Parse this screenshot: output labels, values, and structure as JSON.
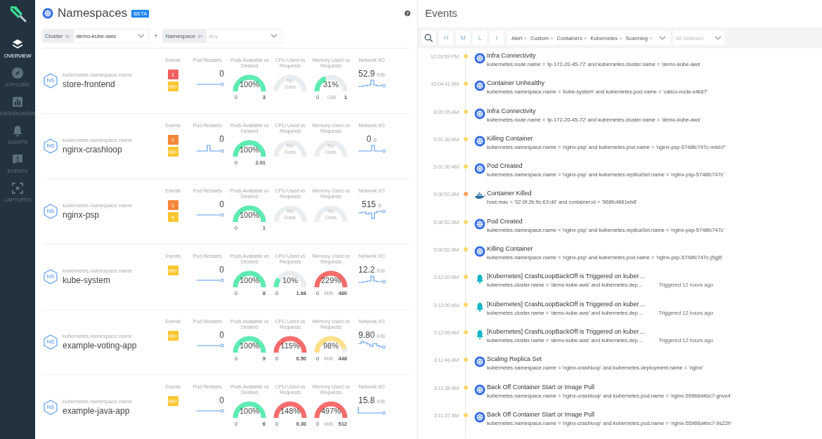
{
  "sidebar": {
    "items": [
      {
        "label": "OVERVIEW",
        "selected": true
      },
      {
        "label": "EXPLORE",
        "selected": false
      },
      {
        "label": "DASHBOARDS",
        "selected": false
      },
      {
        "label": "ALERTS",
        "selected": false
      },
      {
        "label": "EVENTS",
        "selected": false
      },
      {
        "label": "CAPTURES",
        "selected": false
      }
    ]
  },
  "namespaces": {
    "title": "Namespaces",
    "badge": "BETA",
    "help": "?",
    "joiner": "+",
    "filters": [
      {
        "label": "Cluster",
        "operator": "is",
        "value": "demo-kube-aws"
      },
      {
        "label": "Namespace",
        "operator": "in",
        "placeholder": "any"
      }
    ],
    "rows": [
      {
        "field": "kubernetes.namespace.name",
        "name": "store-frontend",
        "icon_text": "NS",
        "headers": [
          "Events",
          "Pod Restarts",
          "Pods Available vs Desired",
          "CPU Used vs Requests",
          "Memory Used vs Requests",
          "Network I/O"
        ],
        "events": [
          {
            "text": "1",
            "color": "#f25e5e"
          },
          {
            "text": "99+",
            "color": "#fcc630"
          }
        ],
        "restarts": {
          "value": "0"
        },
        "gauges": [
          {
            "kind": "gauge",
            "value": "100%",
            "level": 1,
            "color": "#5debb3",
            "min": "0",
            "max": "3"
          },
          {
            "kind": "no_data",
            "value": "No Data"
          },
          {
            "kind": "gauge",
            "value": "31%",
            "level": 0.31,
            "color": "#5debb3",
            "min": "0",
            "max": "1",
            "unit": "GiB"
          }
        ],
        "network": {
          "value": "52.9",
          "unit": "KiB"
        }
      },
      {
        "field": "kubernetes.namespace.name",
        "name": "nginx-crashloop",
        "icon_text": "NS",
        "headers": [
          "Events",
          "Pod Restarts",
          "Pods Available vs Desired",
          "CPU Used vs Requests",
          "Memory Used vs Requests",
          "Network I/O"
        ],
        "events": [
          {
            "text": "1",
            "color": "#f5873a"
          },
          {
            "text": "99+",
            "color": "#fcc630"
          }
        ],
        "restarts": {
          "value": "0"
        },
        "gauges": [
          {
            "kind": "gauge",
            "value": "100%",
            "level": 1,
            "color": "#5debb3",
            "min": "0",
            "max": "2.01"
          },
          {
            "kind": "no_data",
            "value": "No Data"
          },
          {
            "kind": "no_data",
            "value": "No Data"
          }
        ],
        "network": {
          "value": "0",
          "unit": "B"
        }
      },
      {
        "field": "kubernetes.namespace.name",
        "name": "nginx-psp",
        "icon_text": "NS",
        "headers": [
          "Events",
          "Pod Restarts",
          "Pods Available vs Desired",
          "CPU Used vs Requests",
          "Memory Used vs Requests",
          "Network I/O"
        ],
        "events": [
          {
            "text": "1",
            "color": "#f5873a"
          },
          {
            "text": "4",
            "color": "#fcc630"
          }
        ],
        "restarts": {
          "value": "0"
        },
        "gauges": [
          {
            "kind": "gauge",
            "value": "100%",
            "level": 1,
            "color": "#5debb3",
            "min": "0",
            "max": "1"
          },
          {
            "kind": "no_data",
            "value": "No Data"
          },
          {
            "kind": "no_data",
            "value": "No Data"
          }
        ],
        "network": {
          "value": "515",
          "unit": "B"
        }
      },
      {
        "field": "kubernetes.namespace.name",
        "name": "kube-system",
        "icon_text": "NS",
        "headers": [
          "Events",
          "Pod Restarts",
          "Pods Available vs Desired",
          "CPU Used vs Requests",
          "Memory Used vs Requests",
          "Network I/O"
        ],
        "events": [
          {
            "text": "99+",
            "color": "#fcc630"
          }
        ],
        "restarts": {
          "value": "0"
        },
        "gauges": [
          {
            "kind": "gauge",
            "value": "100%",
            "level": 1,
            "color": "#5debb3",
            "min": "0",
            "max": "8"
          },
          {
            "kind": "gauge",
            "value": "10%",
            "level": 0.1,
            "color": "#5debb3",
            "min": "0",
            "max": "1.68"
          },
          {
            "kind": "gauge",
            "value": "229%",
            "level": 1,
            "color": "#f76c6c",
            "min": "0",
            "max": "480",
            "unit": "MiB"
          }
        ],
        "network": {
          "value": "12.2",
          "unit": "KiB"
        }
      },
      {
        "field": "kubernetes.namespace.name",
        "name": "example-voting-app",
        "icon_text": "NS",
        "headers": [
          "Events",
          "Pod Restarts",
          "Pods Available vs Desired",
          "CPU Used vs Requests",
          "Memory Used vs Requests",
          "Network I/O"
        ],
        "events": [
          {
            "text": "99+",
            "color": "#fcc630"
          }
        ],
        "restarts": {
          "value": "0"
        },
        "gauges": [
          {
            "kind": "gauge",
            "value": "100%",
            "level": 1,
            "color": "#5debb3",
            "min": "0",
            "max": "9"
          },
          {
            "kind": "gauge",
            "value": "115%",
            "level": 1,
            "color": "#f76c6c",
            "min": "0",
            "max": "0.50"
          },
          {
            "kind": "gauge",
            "value": "98%",
            "level": 0.98,
            "color": "#fde08a",
            "min": "0",
            "max": "448",
            "unit": "MiB"
          }
        ],
        "network": {
          "value": "9.80",
          "unit": "KiB"
        }
      },
      {
        "field": "kubernetes.namespace.name",
        "name": "example-java-app",
        "icon_text": "NS",
        "headers": [
          "Events",
          "Pod Restarts",
          "Pods Available vs Desired",
          "CPU Used vs Requests",
          "Memory Used vs Requests",
          "Network I/O"
        ],
        "events": [
          {
            "text": "99+",
            "color": "#fcc630"
          }
        ],
        "restarts": {
          "value": "0"
        },
        "gauges": [
          {
            "kind": "gauge",
            "value": "100%",
            "level": 1,
            "color": "#5debb3",
            "min": "0",
            "max": "6"
          },
          {
            "kind": "gauge",
            "value": "148%",
            "level": 1,
            "color": "#f76c6c",
            "min": "0",
            "max": "0.30"
          },
          {
            "kind": "gauge",
            "value": "497%",
            "level": 1,
            "color": "#f76c6c",
            "min": "0",
            "max": "512",
            "unit": "MiB"
          }
        ],
        "network": {
          "value": "15.8",
          "unit": "KiB"
        }
      }
    ]
  },
  "events": {
    "title": "Events",
    "severities": [
      {
        "label": "H",
        "selected": false
      },
      {
        "label": "M",
        "selected": false
      },
      {
        "label": "L",
        "selected": false
      },
      {
        "label": "I",
        "selected": false
      }
    ],
    "tags": [
      {
        "label": "Alert",
        "remove": "×"
      },
      {
        "label": "Custom",
        "remove": "×"
      },
      {
        "label": "Containers",
        "remove": "×"
      },
      {
        "label": "Kubernetes",
        "remove": "×"
      },
      {
        "label": "Scanning",
        "remove": "×"
      }
    ],
    "status": {
      "placeholder": "All Statuses"
    },
    "items": [
      {
        "time": "12:29:59 PM",
        "color": "#fcd86a",
        "kind": "kubernetes",
        "title": "Infra Connectivity",
        "detail": "kubernetes.node.name = 'ip-172-20-45-72' and kubernetes.cluster.name = 'demo-kube-aws'"
      },
      {
        "time": "10:04:41 AM",
        "color": "#fcd86a",
        "kind": "kubernetes",
        "title": "Container Unhealthy",
        "detail": "kubernetes.namespace.name = 'kube-system' and kubernetes.pod.name = 'calico-node-s4k67'"
      },
      {
        "time": "8:09:35 AM",
        "color": "#fcd86a",
        "kind": "kubernetes",
        "title": "Infra Connectivity",
        "detail": "kubernetes.node.name = 'ip-172-20-45-72' and kubernetes.cluster.name = 'demo-kube-aws'"
      },
      {
        "time": "5:01:30 AM",
        "color": "#fcd86a",
        "kind": "kubernetes",
        "title": "Killing Container",
        "detail": "kubernetes.namespace.name = 'nginx-psp' and kubernetes.pod.name = 'nginx-psp-5748fc747c-mlsh7'"
      },
      {
        "time": "5:01:30 AM",
        "color": "#fcd86a",
        "kind": "kubernetes",
        "title": "Pod Created",
        "detail": "kubernetes.namespace.name = 'nginx-psp' and kubernetes.replicaSet.name = 'nginx-psp-5748fc747c'"
      },
      {
        "time": "5:00:52 AM",
        "color": "#f9a05a",
        "kind": "docker",
        "title": "Container Killed",
        "detail": "host.mac = '02:0f:2b:9c:63:d0' and container.id = '968fc4861eb8'"
      },
      {
        "time": "5:00:52 AM",
        "color": "#fcd86a",
        "kind": "kubernetes",
        "title": "Pod Created",
        "detail": "kubernetes.namespace.name = 'nginx-psp' and kubernetes.replicaSet.name = 'nginx-psp-5748fc747c'"
      },
      {
        "time": "5:00:52 AM",
        "color": "#fcd86a",
        "kind": "kubernetes",
        "title": "Killing Container",
        "detail": "kubernetes.namespace.name = 'nginx-psp' and kubernetes.pod.name = 'nginx-psp-5748fc747c-j5gj6'"
      },
      {
        "time": "3:12:00 AM",
        "color": "#fcd86a",
        "kind": "alert",
        "title": "[Kubernetes] CrashLoopBackOff is Triggered on kuber…",
        "detail": "kubernetes.cluster.name = 'demo-kube-aws' and kubernetes.dep…",
        "trigger": "Triggered 12 hours ago"
      },
      {
        "time": "3:12:00 AM",
        "color": "#fcd86a",
        "kind": "alert",
        "title": "[Kubernetes] CrashLoopBackOff is Triggered on kuber…",
        "detail": "kubernetes.cluster.name = 'demo-kube-aws' and kubernetes.dep…",
        "trigger": "Triggered 12 hours ago"
      },
      {
        "time": "3:12:00 AM",
        "color": "#fcd86a",
        "kind": "alert",
        "title": "[Kubernetes] CrashLoopBackOff is Triggered on kuber…",
        "detail": "kubernetes.cluster.name = 'demo-kube-aws' and kubernetes.dep…",
        "trigger": "Triggered 12 hours ago"
      },
      {
        "time": "3:11:46 AM",
        "color": "#fcd86a",
        "kind": "kubernetes",
        "title": "Scaling Replica Set",
        "detail": "kubernetes.namespace.name = 'nginx-crashloop' and kubernetes.deployment.name = 'nginx'"
      },
      {
        "time": "3:11:38 AM",
        "color": "#fcd86a",
        "kind": "kubernetes",
        "title": "Back Off Container Start or Image Pull",
        "detail": "kubernetes.namespace.name = 'nginx-crashloop' and kubernetes.pod.name = 'nginx-55966d4bc7-gnvx4'"
      },
      {
        "time": "3:11:37 AM",
        "color": "#fcd86a",
        "kind": "kubernetes",
        "title": "Back Off Container Start or Image Pull",
        "detail": "kubernetes.namespace.name = 'nginx-crashloop' and kubernetes.pod.name = 'nginx-55966d4bc7-9s22h'"
      }
    ]
  }
}
